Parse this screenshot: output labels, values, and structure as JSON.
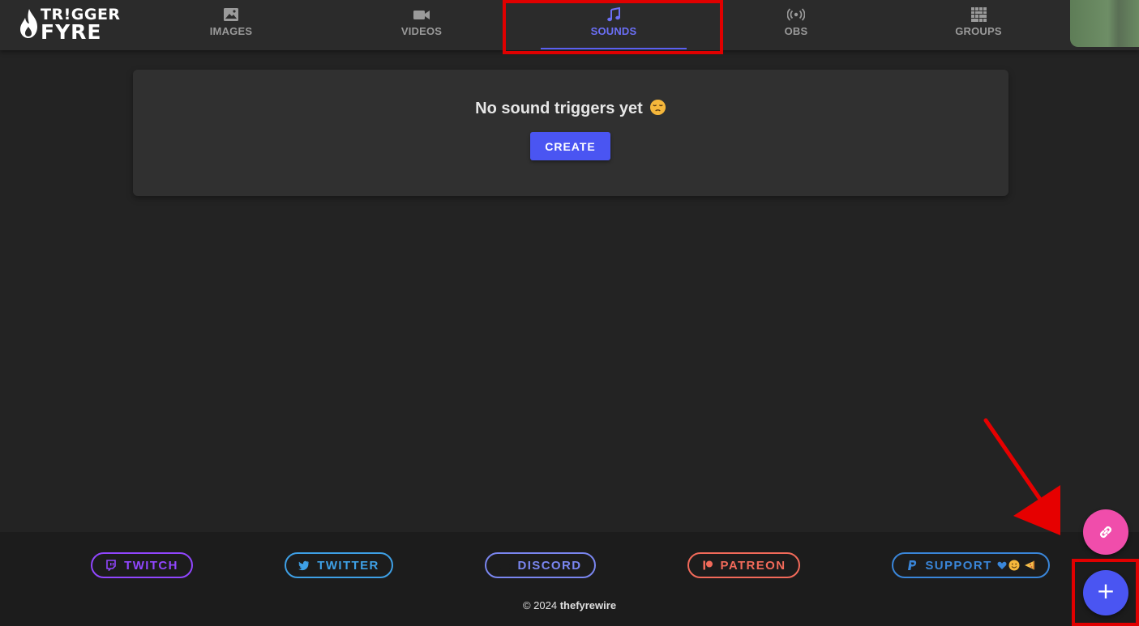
{
  "app": {
    "logo_line1": "TR!GGER",
    "logo_line2": "FYRE"
  },
  "nav": {
    "tabs": [
      {
        "label": "IMAGES",
        "icon": "image-icon",
        "active": false
      },
      {
        "label": "VIDEOS",
        "icon": "video-camera-icon",
        "active": false
      },
      {
        "label": "SOUNDS",
        "icon": "music-note-icon",
        "active": true
      },
      {
        "label": "OBS",
        "icon": "broadcast-icon",
        "active": false
      },
      {
        "label": "GROUPS",
        "icon": "grid-icon",
        "active": false
      }
    ]
  },
  "main": {
    "empty_message": "No sound triggers yet",
    "empty_emoji": "pensive-face-icon",
    "create_label": "CREATE"
  },
  "footer": {
    "links": [
      {
        "label": "TWITCH",
        "icon": "twitch-icon",
        "color": "#9146ff"
      },
      {
        "label": "TWITTER",
        "icon": "twitter-icon",
        "color": "#3ea0e6"
      },
      {
        "label": "DISCORD",
        "icon": "discord-icon",
        "color": "#7a86f0"
      },
      {
        "label": "PATREON",
        "icon": "patreon-icon",
        "color": "#f26a5a"
      },
      {
        "label": "SUPPORT",
        "icon": "paypal-icon",
        "color": "#3a86d9",
        "suffix_icons": [
          "heart-icon",
          "smiley-icon",
          "pizza-icon"
        ]
      }
    ],
    "copyright_prefix": "© 2024",
    "copyright_owner": "thefyrewire"
  },
  "fabs": {
    "link_icon": "link-icon",
    "add_label": "+"
  },
  "colors": {
    "accent": "#4a55f2",
    "active_tab": "#6b6ff6",
    "fab_pink": "#f04dab",
    "highlight_red": "#e00000"
  }
}
